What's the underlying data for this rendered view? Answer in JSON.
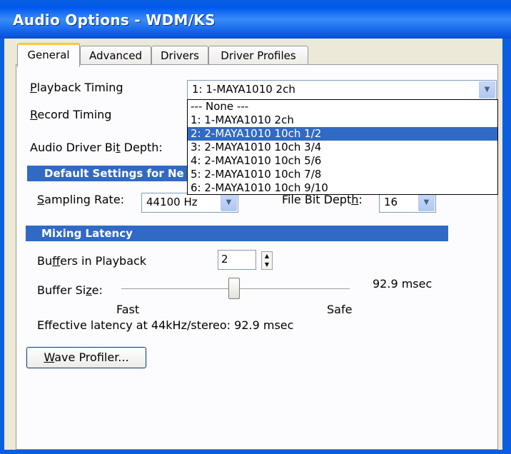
{
  "window": {
    "title": "Audio Options - WDM/KS"
  },
  "tabs": [
    {
      "label": "General",
      "active": true
    },
    {
      "label": "Advanced",
      "active": false
    },
    {
      "label": "Drivers",
      "active": false
    },
    {
      "label": "Driver Profiles",
      "active": false
    }
  ],
  "general": {
    "playback_timing": {
      "label_u": "P",
      "label_rest": "layback Timing",
      "value": "1: 1-MAYA1010 2ch"
    },
    "record_timing": {
      "label_u": "R",
      "label_rest": "ecord Timing"
    },
    "bit_depth_label": {
      "pre": "Audio Driver Bi",
      "u": "t",
      "post": " Depth:"
    },
    "dropdown_options": [
      "--- None ---",
      "1: 1-MAYA1010 2ch",
      "2: 2-MAYA1010 10ch 1/2",
      "3: 2-MAYA1010 10ch 3/4",
      "4: 2-MAYA1010 10ch 5/6",
      "5: 2-MAYA1010 10ch 7/8",
      "6: 2-MAYA1010 10ch 9/10"
    ],
    "selected_option_index": 2,
    "default_settings_header": "Default Settings for Ne",
    "sampling_rate": {
      "label_u": "S",
      "label_rest": "ampling Rate:",
      "value": "44100 Hz"
    },
    "file_bit_depth": {
      "label_pre": "File Bit Dept",
      "label_u": "h",
      "label_post": ":",
      "value": "16"
    },
    "mixing_latency_header": "Mixing Latency",
    "buffers_in_playback": {
      "label_pre": "Bu",
      "label_u": "f",
      "label_post": "fers in Playback",
      "value": "2"
    },
    "buffer_size": {
      "label_pre": "Buffer Si",
      "label_u": "z",
      "label_post": "e:",
      "readout": "92.9 msec",
      "slider_fraction": 0.49
    },
    "slider_min_label": "Fast",
    "slider_max_label": "Safe",
    "effective_latency": "Effective latency at 44kHz/stereo:  92.9 msec",
    "wave_profiler": {
      "label_u": "W",
      "label_rest": "ave Profiler..."
    }
  },
  "colors": {
    "titlebar": "#0058ee",
    "section": "#316ac5",
    "selection": "#316ac5",
    "active_tab_accent": "#ffc83c"
  }
}
